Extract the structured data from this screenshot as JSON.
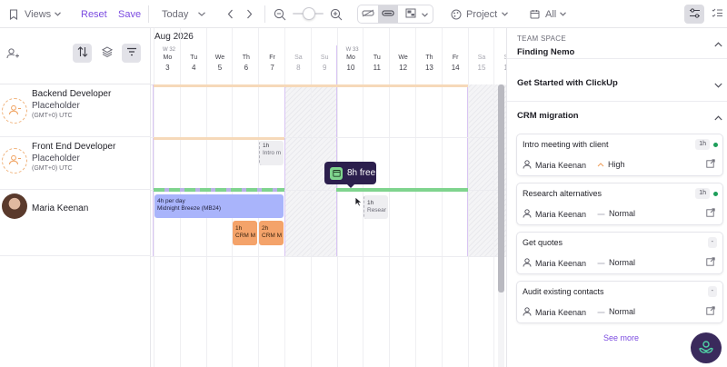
{
  "toolbar": {
    "views_label": "Views",
    "reset_label": "Reset",
    "save_label": "Save",
    "today_label": "Today",
    "project_label": "Project",
    "all_label": "All"
  },
  "calendar": {
    "month_label": "Aug 2026",
    "week_labels": [
      "W 32",
      "W 33"
    ],
    "days": [
      {
        "dow": "Mo",
        "num": "3",
        "weekend": false
      },
      {
        "dow": "Tu",
        "num": "4",
        "weekend": false
      },
      {
        "dow": "We",
        "num": "5",
        "weekend": false
      },
      {
        "dow": "Th",
        "num": "6",
        "weekend": false
      },
      {
        "dow": "Fr",
        "num": "7",
        "weekend": false
      },
      {
        "dow": "Sa",
        "num": "8",
        "weekend": true
      },
      {
        "dow": "Su",
        "num": "9",
        "weekend": true
      },
      {
        "dow": "Mo",
        "num": "10",
        "weekend": false
      },
      {
        "dow": "Tu",
        "num": "11",
        "weekend": false
      },
      {
        "dow": "We",
        "num": "12",
        "weekend": false
      },
      {
        "dow": "Th",
        "num": "13",
        "weekend": false
      },
      {
        "dow": "Fr",
        "num": "14",
        "weekend": false
      },
      {
        "dow": "Sa",
        "num": "15",
        "weekend": true
      },
      {
        "dow": "Su",
        "num": "16",
        "weekend": true
      }
    ]
  },
  "people": [
    {
      "name": "Backend Developer",
      "role": "Placeholder",
      "tz": "(GMT+0) UTC"
    },
    {
      "name": "Front End Developer",
      "role": "Placeholder",
      "tz": "(GMT+0) UTC"
    },
    {
      "name": "Maria Keenan"
    }
  ],
  "tasks": {
    "frontend_1h_label": "1h",
    "frontend_1h_sub": "Intro m",
    "maria_block_line1": "4h per day",
    "maria_block_line2": "Midnight Breeze (MB24)",
    "crm1_label": "1h",
    "crm1_sub": "CRM M",
    "crm2_label": "2h",
    "crm2_sub": "CRM M",
    "research_label": "1h",
    "research_sub": "Resear"
  },
  "tooltip": {
    "text": "8h free"
  },
  "sidebar": {
    "space_label": "TEAM SPACE",
    "sections": [
      "Finding Nemo",
      "Get Started with ClickUp",
      "CRM migration"
    ],
    "cards": [
      {
        "title": "Intro meeting with client",
        "badge": "1h",
        "assignee": "Maria Keenan",
        "priority": "High",
        "has_dot": true
      },
      {
        "title": "Research alternatives",
        "badge": "1h",
        "assignee": "Maria Keenan",
        "priority": "Normal",
        "has_dot": true
      },
      {
        "title": "Get quotes",
        "badge": "-",
        "assignee": "Maria Keenan",
        "priority": "Normal",
        "has_dot": false
      },
      {
        "title": "Audit existing contacts",
        "badge": "-",
        "assignee": "Maria Keenan",
        "priority": "Normal",
        "has_dot": false
      }
    ],
    "see_more_label": "See more"
  },
  "colors": {
    "accent": "#7b4be0",
    "task_blue": "#a9b4fb",
    "task_orange": "#f4a36a",
    "available_green": "#7fd48e",
    "placeholder_bar": "#f6d9b9"
  }
}
